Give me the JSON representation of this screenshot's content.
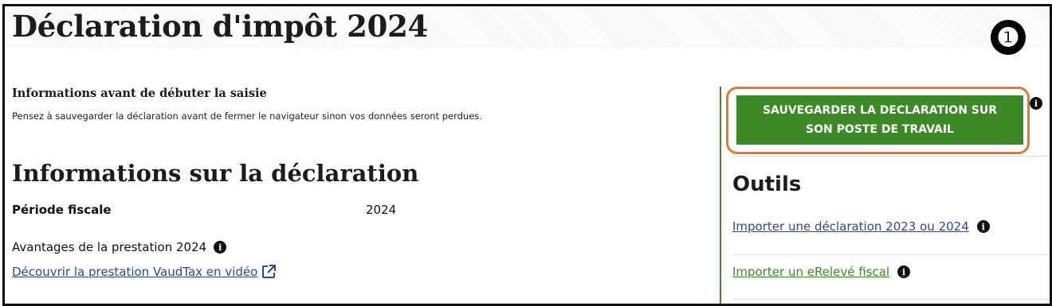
{
  "header": {
    "title": "Déclaration d'impôt 2024",
    "step_badge": "❶"
  },
  "notice": {
    "title": "Informations avant de débuter la saisie",
    "text": "Pensez à sauvegarder la déclaration avant de fermer le navigateur sinon vos données seront perdues."
  },
  "declaration_info": {
    "section_title": "Informations sur la déclaration",
    "period_label": "Période fiscale",
    "period_value": "2024",
    "advantages_label": "Avantages de la prestation 2024",
    "video_link": "Découvrir la prestation VaudTax en vidéo"
  },
  "sidebar": {
    "save_button": {
      "line1": "SAUVEGARDER LA DECLARATION SUR",
      "line2": "SON POSTE DE TRAVAIL"
    },
    "tools_title": "Outils",
    "links": [
      {
        "label": "Importer une déclaration 2023 ou 2024"
      },
      {
        "label": "Importer un eRelevé fiscal"
      }
    ]
  },
  "icons": {
    "info": "info-circle-icon",
    "external_link": "external-link-icon"
  },
  "colors": {
    "accent_green": "#3b8a25",
    "highlight_orange": "#e07a2c",
    "link_blue": "#2a4a8f",
    "link_green": "#3b8a25"
  }
}
